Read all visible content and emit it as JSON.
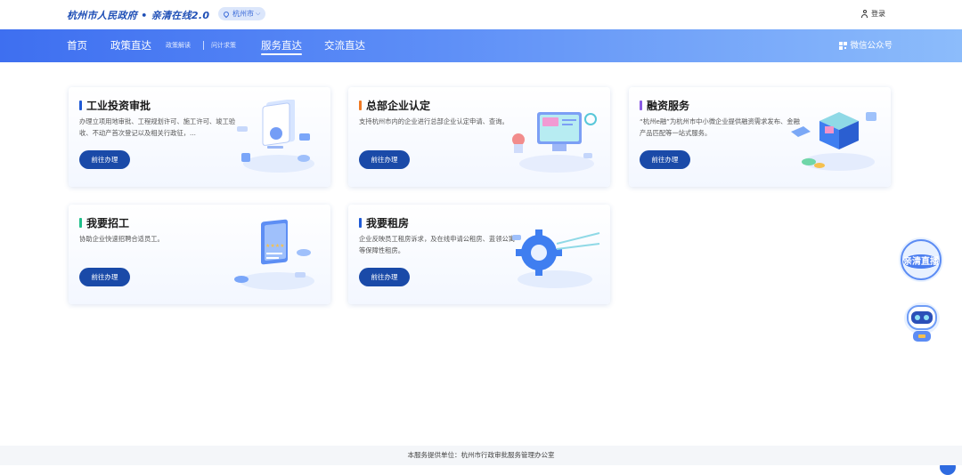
{
  "header": {
    "brand": "杭州市人民政府 • 亲清在线2.0",
    "city": "杭州市",
    "login_label": "登录"
  },
  "nav": {
    "home": "首页",
    "policy": "政策直达",
    "policy_interpret": "政策解读",
    "ask_plan": "问计求策",
    "service": "服务直达",
    "exchange": "交流直达",
    "wechat": "微信公众号"
  },
  "cards": [
    {
      "title": "工业投资审批",
      "desc": "办理立项用地审批、工程规划许可、施工许可、竣工验收、不动产首次登记以及相关行政征，...",
      "button": "前往办理",
      "accent": "#1f5ad6"
    },
    {
      "title": "总部企业认定",
      "desc": "支持杭州市内的企业进行总部企业认定申请、查询。",
      "button": "前往办理",
      "accent": "#f07a24"
    },
    {
      "title": "融资服务",
      "desc": "“杭州e融”为杭州市中小微企业提供融资需求发布、金融产品匹配等一站式服务。",
      "button": "前往办理",
      "accent": "#8a5be3"
    },
    {
      "title": "我要招工",
      "desc": "协助企业快速招聘合适员工。",
      "button": "前往办理",
      "accent": "#1fbf8a"
    },
    {
      "title": "我要租房",
      "desc": "企业反映员工租房诉求，及在线申请公租房、蓝领公寓等保障性租房。",
      "button": "前往办理",
      "accent": "#1f5ad6"
    }
  ],
  "float": {
    "live_label": "亲清直播"
  },
  "footer": {
    "text": "本服务提供单位：杭州市行政审批服务管理办公室"
  },
  "icons": [
    "location-pin-icon",
    "user-icon",
    "qr-code-icon",
    "chevron-down-icon"
  ]
}
